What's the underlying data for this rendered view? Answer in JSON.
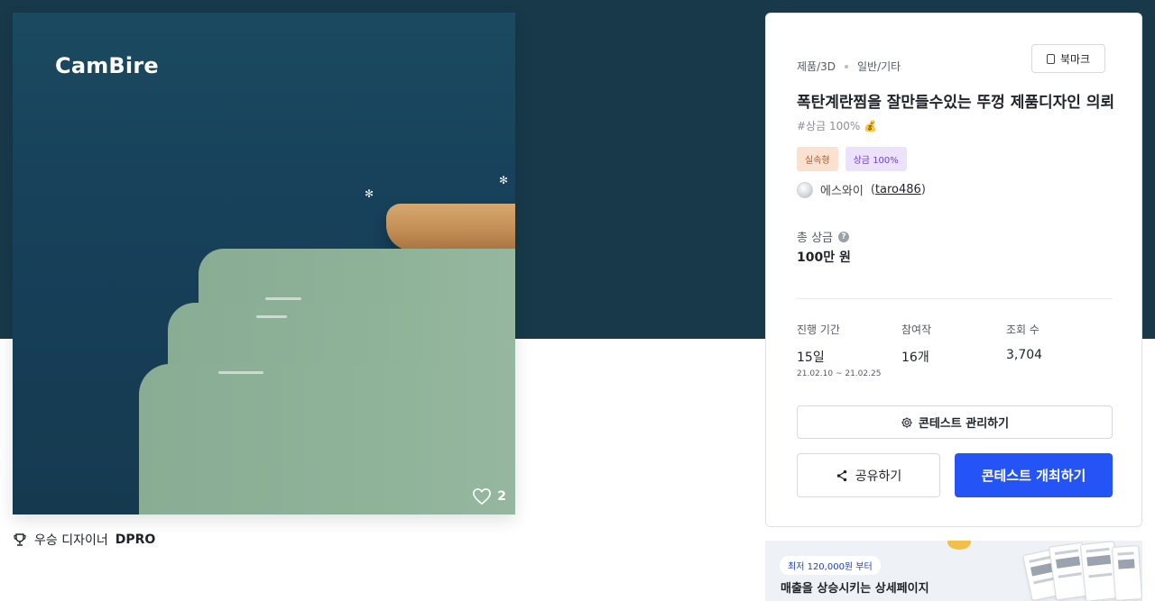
{
  "image": {
    "brand_logo": "CamBire",
    "like_count": "2",
    "heart_icon": "heart-outline-icon"
  },
  "winner": {
    "icon": "trophy-icon",
    "label": "우승 디자이너",
    "name": "DPRO"
  },
  "panel": {
    "category_main": "제품/3D",
    "category_sub": "일반/기타",
    "bookmark_label": "북마크",
    "title": "폭탄계란찜을 잘만들수있는 뚜껑 제품디자인 의뢰",
    "hashtag": "#상금 100%",
    "tags": [
      "실속형",
      "상금 100%"
    ],
    "host_name": "에스와이",
    "host_id": "taro486",
    "total_prize_label": "총 상금",
    "total_prize_value": "100만 원",
    "stats": {
      "period_label": "진행 기간",
      "period_value": "15일",
      "period_dates": "21.02.10 ~ 21.02.25",
      "entries_label": "참여작",
      "entries_value": "16개",
      "views_label": "조회 수",
      "views_value": "3,704"
    },
    "manage_button": "콘테스트 관리하기",
    "share_button": "공유하기",
    "host_button": "콘테스트 개최하기"
  },
  "ad": {
    "badge": "최저 120,000원 부터",
    "text": "매출을 상승시키는 상세페이지"
  },
  "colors": {
    "hero_bg": "#18394a",
    "primary_button": "#2454f5",
    "tag_a_bg": "#fbe1d0",
    "tag_b_bg": "#ece2fb"
  }
}
